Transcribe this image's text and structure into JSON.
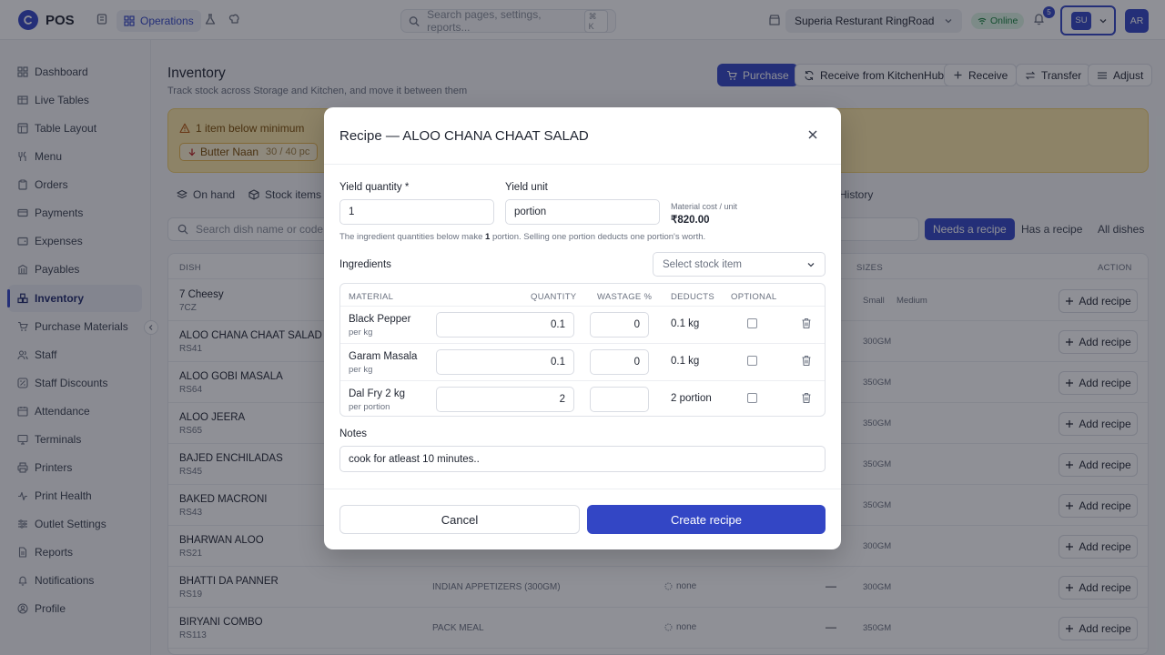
{
  "app": {
    "name": "POS"
  },
  "topbar": {
    "ops_label": "Operations",
    "search_placeholder": "Search pages, settings, reports...",
    "search_shortcut": "⌘ K",
    "outlet": "Superia Resturant RingRoad",
    "status": "Online",
    "notifications_count": "5",
    "user_initials": "SU",
    "account_initials": "AR"
  },
  "sidebar": {
    "items": [
      {
        "label": "Dashboard",
        "icon": "dashboard-icon"
      },
      {
        "label": "Live Tables",
        "icon": "table-icon"
      },
      {
        "label": "Table Layout",
        "icon": "layout-icon"
      },
      {
        "label": "Menu",
        "icon": "utensils-icon"
      },
      {
        "label": "Orders",
        "icon": "clipboard-icon"
      },
      {
        "label": "Payments",
        "icon": "card-icon"
      },
      {
        "label": "Expenses",
        "icon": "wallet-icon"
      },
      {
        "label": "Payables",
        "icon": "bank-icon"
      },
      {
        "label": "Inventory",
        "icon": "boxes-icon"
      },
      {
        "label": "Purchase Materials",
        "icon": "cart-icon"
      },
      {
        "label": "Staff",
        "icon": "users-icon"
      },
      {
        "label": "Staff Discounts",
        "icon": "percent-icon"
      },
      {
        "label": "Attendance",
        "icon": "calendar-icon"
      },
      {
        "label": "Terminals",
        "icon": "monitor-icon"
      },
      {
        "label": "Printers",
        "icon": "printer-icon"
      },
      {
        "label": "Print Health",
        "icon": "activity-icon"
      },
      {
        "label": "Outlet Settings",
        "icon": "sliders-icon"
      },
      {
        "label": "Reports",
        "icon": "file-icon"
      },
      {
        "label": "Notifications",
        "icon": "bell-icon"
      },
      {
        "label": "Profile",
        "icon": "user-icon"
      }
    ],
    "active": "Inventory"
  },
  "page": {
    "title": "Inventory",
    "subtitle": "Track stock across Storage and Kitchen, and move it between them",
    "actions": {
      "purchase": "Purchase",
      "receive_kitchenhub": "Receive from KitchenHub",
      "receive": "Receive",
      "transfer": "Transfer",
      "adjust": "Adjust"
    },
    "alert": {
      "title": "1 item below minimum",
      "chip_name": "Butter Naan",
      "chip_detail": "30 / 40 pc"
    },
    "tabs": {
      "on_hand": "On hand",
      "stock_items": "Stock items",
      "history": "History"
    },
    "filter_placeholder": "Search dish name or code...",
    "segments": {
      "needs": "Needs a recipe",
      "has": "Has a recipe",
      "all": "All dishes"
    }
  },
  "table": {
    "headers": {
      "dish": "DISH",
      "sizes": "SIZES",
      "action": "ACTION"
    },
    "rows": [
      {
        "name": "7 Cheesy",
        "code": "7CZ",
        "size1": "Small",
        "size2": "Medium",
        "btn": "Add recipe"
      },
      {
        "name": "ALOO CHANA CHAAT SALAD",
        "code": "RS41",
        "size1": "300GM",
        "btn": "Add recipe"
      },
      {
        "name": "ALOO GOBI MASALA",
        "code": "RS64",
        "size1": "350GM",
        "btn": "Add recipe"
      },
      {
        "name": "ALOO JEERA",
        "code": "RS65",
        "size1": "350GM",
        "btn": "Add recipe"
      },
      {
        "name": "BAJED ENCHILADAS",
        "code": "RS45",
        "size1": "350GM",
        "btn": "Add recipe"
      },
      {
        "name": "BAKED MACRONI",
        "code": "RS43",
        "size1": "350GM",
        "btn": "Add recipe"
      },
      {
        "name": "BHARWAN ALOO",
        "code": "RS21",
        "size1": "300GM",
        "btn": "Add recipe"
      },
      {
        "name": "BHATTI DA PANNER",
        "code": "RS19",
        "category": "INDIAN APPETIZERS (300GM)",
        "status": "none",
        "dash": "—",
        "size1": "300GM",
        "btn": "Add recipe"
      },
      {
        "name": "BIRYANI COMBO",
        "code": "RS113",
        "category": "PACK MEAL",
        "status": "none",
        "dash": "—",
        "size1": "350GM",
        "btn": "Add recipe"
      }
    ]
  },
  "modal": {
    "title": "Recipe — ALOO CHANA CHAAT SALAD",
    "yield_qty_label": "Yield quantity *",
    "yield_qty_value": "1",
    "yield_unit_label": "Yield unit",
    "yield_unit_value": "portion",
    "cost_label": "Material cost / unit",
    "cost_value": "₹820.00",
    "hint_pre": "The ingredient quantities below make ",
    "hint_bold": "1",
    "hint_post": " portion. Selling one portion deducts one portion's worth.",
    "ingredients_label": "Ingredients",
    "select_placeholder": "Select stock item",
    "headers": {
      "material": "MATERIAL",
      "quantity": "QUANTITY",
      "wastage": "WASTAGE %",
      "deducts": "DEDUCTS",
      "optional": "OPTIONAL"
    },
    "ingredients": [
      {
        "name": "Black Pepper",
        "unit": "per kg",
        "qty": "0.1",
        "wastage": "0",
        "deducts": "0.1 kg"
      },
      {
        "name": "Garam Masala",
        "unit": "per kg",
        "qty": "0.1",
        "wastage": "0",
        "deducts": "0.1 kg"
      },
      {
        "name": "Dal Fry 2 kg",
        "unit": "per portion",
        "qty": "2",
        "wastage": "",
        "deducts": "2 portion"
      }
    ],
    "notes_label": "Notes",
    "notes_value": "cook for atleast 10 minutes..",
    "cancel": "Cancel",
    "create": "Create recipe"
  }
}
